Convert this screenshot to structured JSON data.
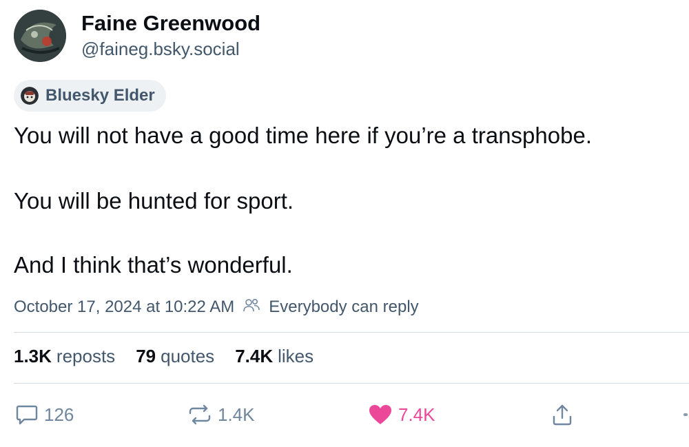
{
  "author": {
    "display_name": "Faine Greenwood",
    "handle": "@faineg.bsky.social"
  },
  "badge": {
    "label": "Bluesky Elder"
  },
  "post": {
    "lines": [
      "You will not have a good time here if you’re a transphobe.",
      "You will be hunted for sport.",
      "And I think that’s wonderful."
    ],
    "timestamp": "October 17, 2024 at 10:22 AM",
    "reply_setting": "Everybody can reply"
  },
  "stats": {
    "reposts": {
      "count": "1.3K",
      "label": "reposts"
    },
    "quotes": {
      "count": "79",
      "label": "quotes"
    },
    "likes": {
      "count": "7.4K",
      "label": "likes"
    }
  },
  "actions": {
    "reply": {
      "icon": "reply-icon",
      "count": "126"
    },
    "repost": {
      "icon": "repost-icon",
      "count": "1.4K"
    },
    "like": {
      "icon": "heart-icon",
      "count": "7.4K",
      "liked": true
    },
    "share": {
      "icon": "share-icon"
    }
  },
  "colors": {
    "text": "#0b0f14",
    "muted": "#42576c",
    "action": "#6f869f",
    "like": "#ec4899",
    "badge_bg": "#eef1f4",
    "divider": "#d4dbe2"
  }
}
